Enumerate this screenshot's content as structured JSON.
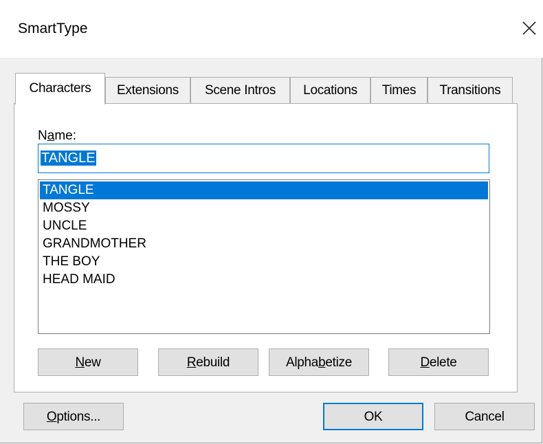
{
  "window": {
    "title": "SmartType",
    "close_glyph": "close-icon"
  },
  "tabs": [
    {
      "label": "Characters",
      "active": true
    },
    {
      "label": "Extensions",
      "active": false
    },
    {
      "label": "Scene Intros",
      "active": false
    },
    {
      "label": "Locations",
      "active": false
    },
    {
      "label": "Times",
      "active": false
    },
    {
      "label": "Transitions",
      "active": false
    }
  ],
  "name_field": {
    "label_prefix": "N",
    "label_mnemonic": "a",
    "label_suffix": "me:",
    "value": "TANGLE"
  },
  "list": {
    "items": [
      "TANGLE",
      "MOSSY",
      "UNCLE",
      "GRANDMOTHER",
      "THE BOY",
      "HEAD MAID"
    ],
    "selected_index": 0
  },
  "panel_buttons": {
    "new_mn": "N",
    "new_rest": "ew",
    "rebuild_mn": "R",
    "rebuild_rest": "ebuild",
    "alpha_pre": "Alpha",
    "alpha_mn": "b",
    "alpha_post": "etize",
    "delete_mn": "D",
    "delete_rest": "elete"
  },
  "footer_buttons": {
    "options_mn": "O",
    "options_rest": "ptions...",
    "ok": "OK",
    "cancel": "Cancel"
  },
  "colors": {
    "accent": "#0078d7",
    "button_face": "#e1e1e1",
    "dialog_bg": "#f0f0f0"
  }
}
